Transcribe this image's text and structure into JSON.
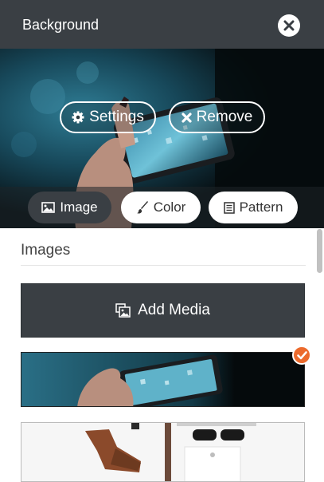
{
  "header": {
    "title": "Background"
  },
  "preview": {
    "settings_label": "Settings",
    "remove_label": "Remove"
  },
  "tabs": [
    {
      "label": "Image",
      "active": true,
      "icon": "image-icon"
    },
    {
      "label": "Color",
      "active": false,
      "icon": "brush-icon"
    },
    {
      "label": "Pattern",
      "active": false,
      "icon": "pattern-icon"
    }
  ],
  "images_section": {
    "title": "Images",
    "add_media_label": "Add Media"
  },
  "colors": {
    "dark": "#3a3f44",
    "accent": "#ec6a2c",
    "white": "#ffffff"
  }
}
